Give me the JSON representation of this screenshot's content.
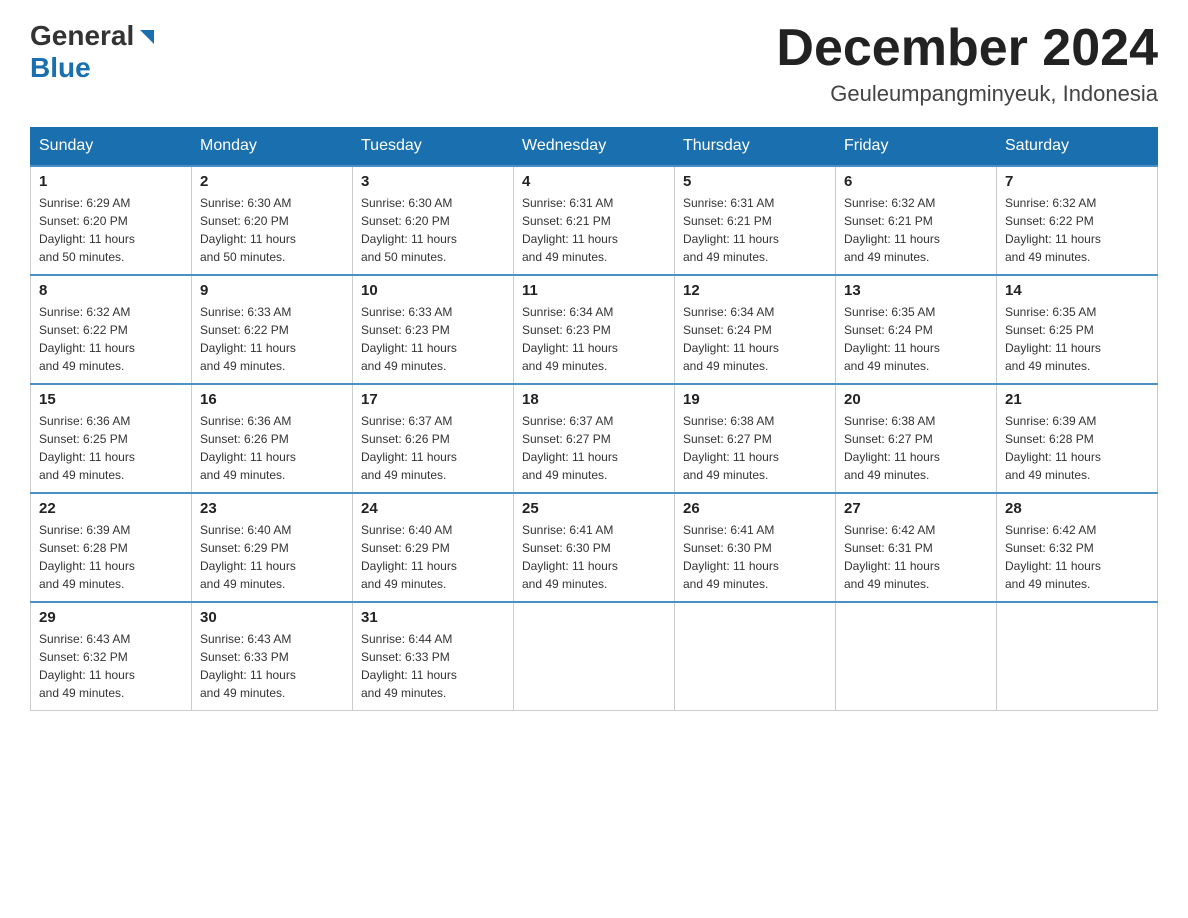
{
  "header": {
    "logo_general": "General",
    "logo_blue": "Blue",
    "month_title": "December 2024",
    "location": "Geuleumpangminyeuk, Indonesia"
  },
  "days_of_week": [
    "Sunday",
    "Monday",
    "Tuesday",
    "Wednesday",
    "Thursday",
    "Friday",
    "Saturday"
  ],
  "weeks": [
    [
      {
        "day": "1",
        "sunrise": "6:29 AM",
        "sunset": "6:20 PM",
        "daylight": "11 hours and 50 minutes."
      },
      {
        "day": "2",
        "sunrise": "6:30 AM",
        "sunset": "6:20 PM",
        "daylight": "11 hours and 50 minutes."
      },
      {
        "day": "3",
        "sunrise": "6:30 AM",
        "sunset": "6:20 PM",
        "daylight": "11 hours and 50 minutes."
      },
      {
        "day": "4",
        "sunrise": "6:31 AM",
        "sunset": "6:21 PM",
        "daylight": "11 hours and 49 minutes."
      },
      {
        "day": "5",
        "sunrise": "6:31 AM",
        "sunset": "6:21 PM",
        "daylight": "11 hours and 49 minutes."
      },
      {
        "day": "6",
        "sunrise": "6:32 AM",
        "sunset": "6:21 PM",
        "daylight": "11 hours and 49 minutes."
      },
      {
        "day": "7",
        "sunrise": "6:32 AM",
        "sunset": "6:22 PM",
        "daylight": "11 hours and 49 minutes."
      }
    ],
    [
      {
        "day": "8",
        "sunrise": "6:32 AM",
        "sunset": "6:22 PM",
        "daylight": "11 hours and 49 minutes."
      },
      {
        "day": "9",
        "sunrise": "6:33 AM",
        "sunset": "6:22 PM",
        "daylight": "11 hours and 49 minutes."
      },
      {
        "day": "10",
        "sunrise": "6:33 AM",
        "sunset": "6:23 PM",
        "daylight": "11 hours and 49 minutes."
      },
      {
        "day": "11",
        "sunrise": "6:34 AM",
        "sunset": "6:23 PM",
        "daylight": "11 hours and 49 minutes."
      },
      {
        "day": "12",
        "sunrise": "6:34 AM",
        "sunset": "6:24 PM",
        "daylight": "11 hours and 49 minutes."
      },
      {
        "day": "13",
        "sunrise": "6:35 AM",
        "sunset": "6:24 PM",
        "daylight": "11 hours and 49 minutes."
      },
      {
        "day": "14",
        "sunrise": "6:35 AM",
        "sunset": "6:25 PM",
        "daylight": "11 hours and 49 minutes."
      }
    ],
    [
      {
        "day": "15",
        "sunrise": "6:36 AM",
        "sunset": "6:25 PM",
        "daylight": "11 hours and 49 minutes."
      },
      {
        "day": "16",
        "sunrise": "6:36 AM",
        "sunset": "6:26 PM",
        "daylight": "11 hours and 49 minutes."
      },
      {
        "day": "17",
        "sunrise": "6:37 AM",
        "sunset": "6:26 PM",
        "daylight": "11 hours and 49 minutes."
      },
      {
        "day": "18",
        "sunrise": "6:37 AM",
        "sunset": "6:27 PM",
        "daylight": "11 hours and 49 minutes."
      },
      {
        "day": "19",
        "sunrise": "6:38 AM",
        "sunset": "6:27 PM",
        "daylight": "11 hours and 49 minutes."
      },
      {
        "day": "20",
        "sunrise": "6:38 AM",
        "sunset": "6:27 PM",
        "daylight": "11 hours and 49 minutes."
      },
      {
        "day": "21",
        "sunrise": "6:39 AM",
        "sunset": "6:28 PM",
        "daylight": "11 hours and 49 minutes."
      }
    ],
    [
      {
        "day": "22",
        "sunrise": "6:39 AM",
        "sunset": "6:28 PM",
        "daylight": "11 hours and 49 minutes."
      },
      {
        "day": "23",
        "sunrise": "6:40 AM",
        "sunset": "6:29 PM",
        "daylight": "11 hours and 49 minutes."
      },
      {
        "day": "24",
        "sunrise": "6:40 AM",
        "sunset": "6:29 PM",
        "daylight": "11 hours and 49 minutes."
      },
      {
        "day": "25",
        "sunrise": "6:41 AM",
        "sunset": "6:30 PM",
        "daylight": "11 hours and 49 minutes."
      },
      {
        "day": "26",
        "sunrise": "6:41 AM",
        "sunset": "6:30 PM",
        "daylight": "11 hours and 49 minutes."
      },
      {
        "day": "27",
        "sunrise": "6:42 AM",
        "sunset": "6:31 PM",
        "daylight": "11 hours and 49 minutes."
      },
      {
        "day": "28",
        "sunrise": "6:42 AM",
        "sunset": "6:32 PM",
        "daylight": "11 hours and 49 minutes."
      }
    ],
    [
      {
        "day": "29",
        "sunrise": "6:43 AM",
        "sunset": "6:32 PM",
        "daylight": "11 hours and 49 minutes."
      },
      {
        "day": "30",
        "sunrise": "6:43 AM",
        "sunset": "6:33 PM",
        "daylight": "11 hours and 49 minutes."
      },
      {
        "day": "31",
        "sunrise": "6:44 AM",
        "sunset": "6:33 PM",
        "daylight": "11 hours and 49 minutes."
      },
      null,
      null,
      null,
      null
    ]
  ],
  "labels": {
    "sunrise": "Sunrise:",
    "sunset": "Sunset:",
    "daylight": "Daylight:"
  }
}
